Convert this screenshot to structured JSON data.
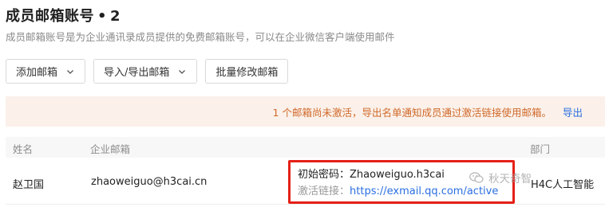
{
  "header": {
    "title": "成员邮箱账号",
    "dot": "•",
    "count": "2",
    "subtitle": "成员邮箱账号是为企业通讯录成员提供的免费邮箱账号，可以在企业微信客户端使用邮件"
  },
  "toolbar": {
    "add_mailbox": "添加邮箱",
    "import_export": "导入/导出邮箱",
    "batch_edit": "批量修改邮箱"
  },
  "notice": {
    "text": "1 个邮箱尚未激活，导出名单通知成员通过激活链接使用邮箱。",
    "action": "导出",
    "text_color": "#d0692a",
    "background": "#fbf1ea"
  },
  "table": {
    "headers": {
      "name": "姓名",
      "email": "企业邮箱",
      "dept": "部门"
    },
    "rows": [
      {
        "name": "赵卫国",
        "email": "zhaoweiguo@h3cai.cn",
        "password_label": "初始密码：",
        "password_value": "Zhaoweiguo.h3cai",
        "activation_label": "激活链接：",
        "activation_link": "https://exmail.qq.com/active",
        "dept": "H4C人工智能"
      }
    ]
  },
  "overlay": {
    "watermark_text": "秋天奇智",
    "highlight_color": "#e52018",
    "icon": "wechat-icon"
  },
  "colors": {
    "link": "#2a6fe0",
    "muted": "#8a8a8a"
  }
}
